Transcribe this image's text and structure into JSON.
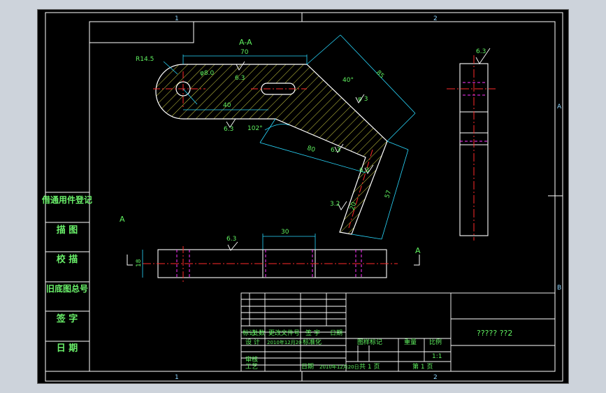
{
  "frame": {
    "zone_top_1": "1",
    "zone_top_2": "2",
    "zone_bottom_1": "1",
    "zone_bottom_2": "2",
    "zone_right_a": "A",
    "zone_right_b": "B"
  },
  "views": {
    "section_title": "A-A",
    "section_marker_left": "A",
    "section_marker_right": "A"
  },
  "dimensions": {
    "r_left": "R14.5",
    "len_top": "70",
    "len_bottom": "40",
    "hole_dia": "φ8.0",
    "angle_1": "40°",
    "angle_2": "102°",
    "dia_side": "φ 3",
    "len_slant": "85",
    "len_mid": "80",
    "len_right": "57",
    "len_small": "20",
    "len_top_view": "30",
    "height_top_view": "18"
  },
  "roughness": {
    "r1": "6.3",
    "r2": "6.3",
    "r3": "6.3",
    "r4": "6.3",
    "r5": "3.2",
    "r6": "6.3",
    "r7": "6.3"
  },
  "left_column": {
    "row1": "借通用件登记",
    "row2": "描 图",
    "row3": "校 描",
    "row4": "旧底图总号",
    "row5": "签 字",
    "row6": "日 期"
  },
  "title_block": {
    "h_mark": "标记",
    "h_count": "处数",
    "h_doc": "更改文件号",
    "h_sign": "签 字",
    "h_date": "日期",
    "design": "设 计",
    "design_date": "2010年12月20",
    "std": "标准化",
    "check": "审核",
    "craft": "工艺",
    "date_label": "日期",
    "date_value": "2010年12月20日",
    "stage_mark": "图样标记",
    "weight": "重量",
    "scale": "比例",
    "scale_value": "1:1",
    "total_sheets": "共 1 页",
    "sheet_no": "第 1 页",
    "drawing_name": "????? ??2"
  }
}
